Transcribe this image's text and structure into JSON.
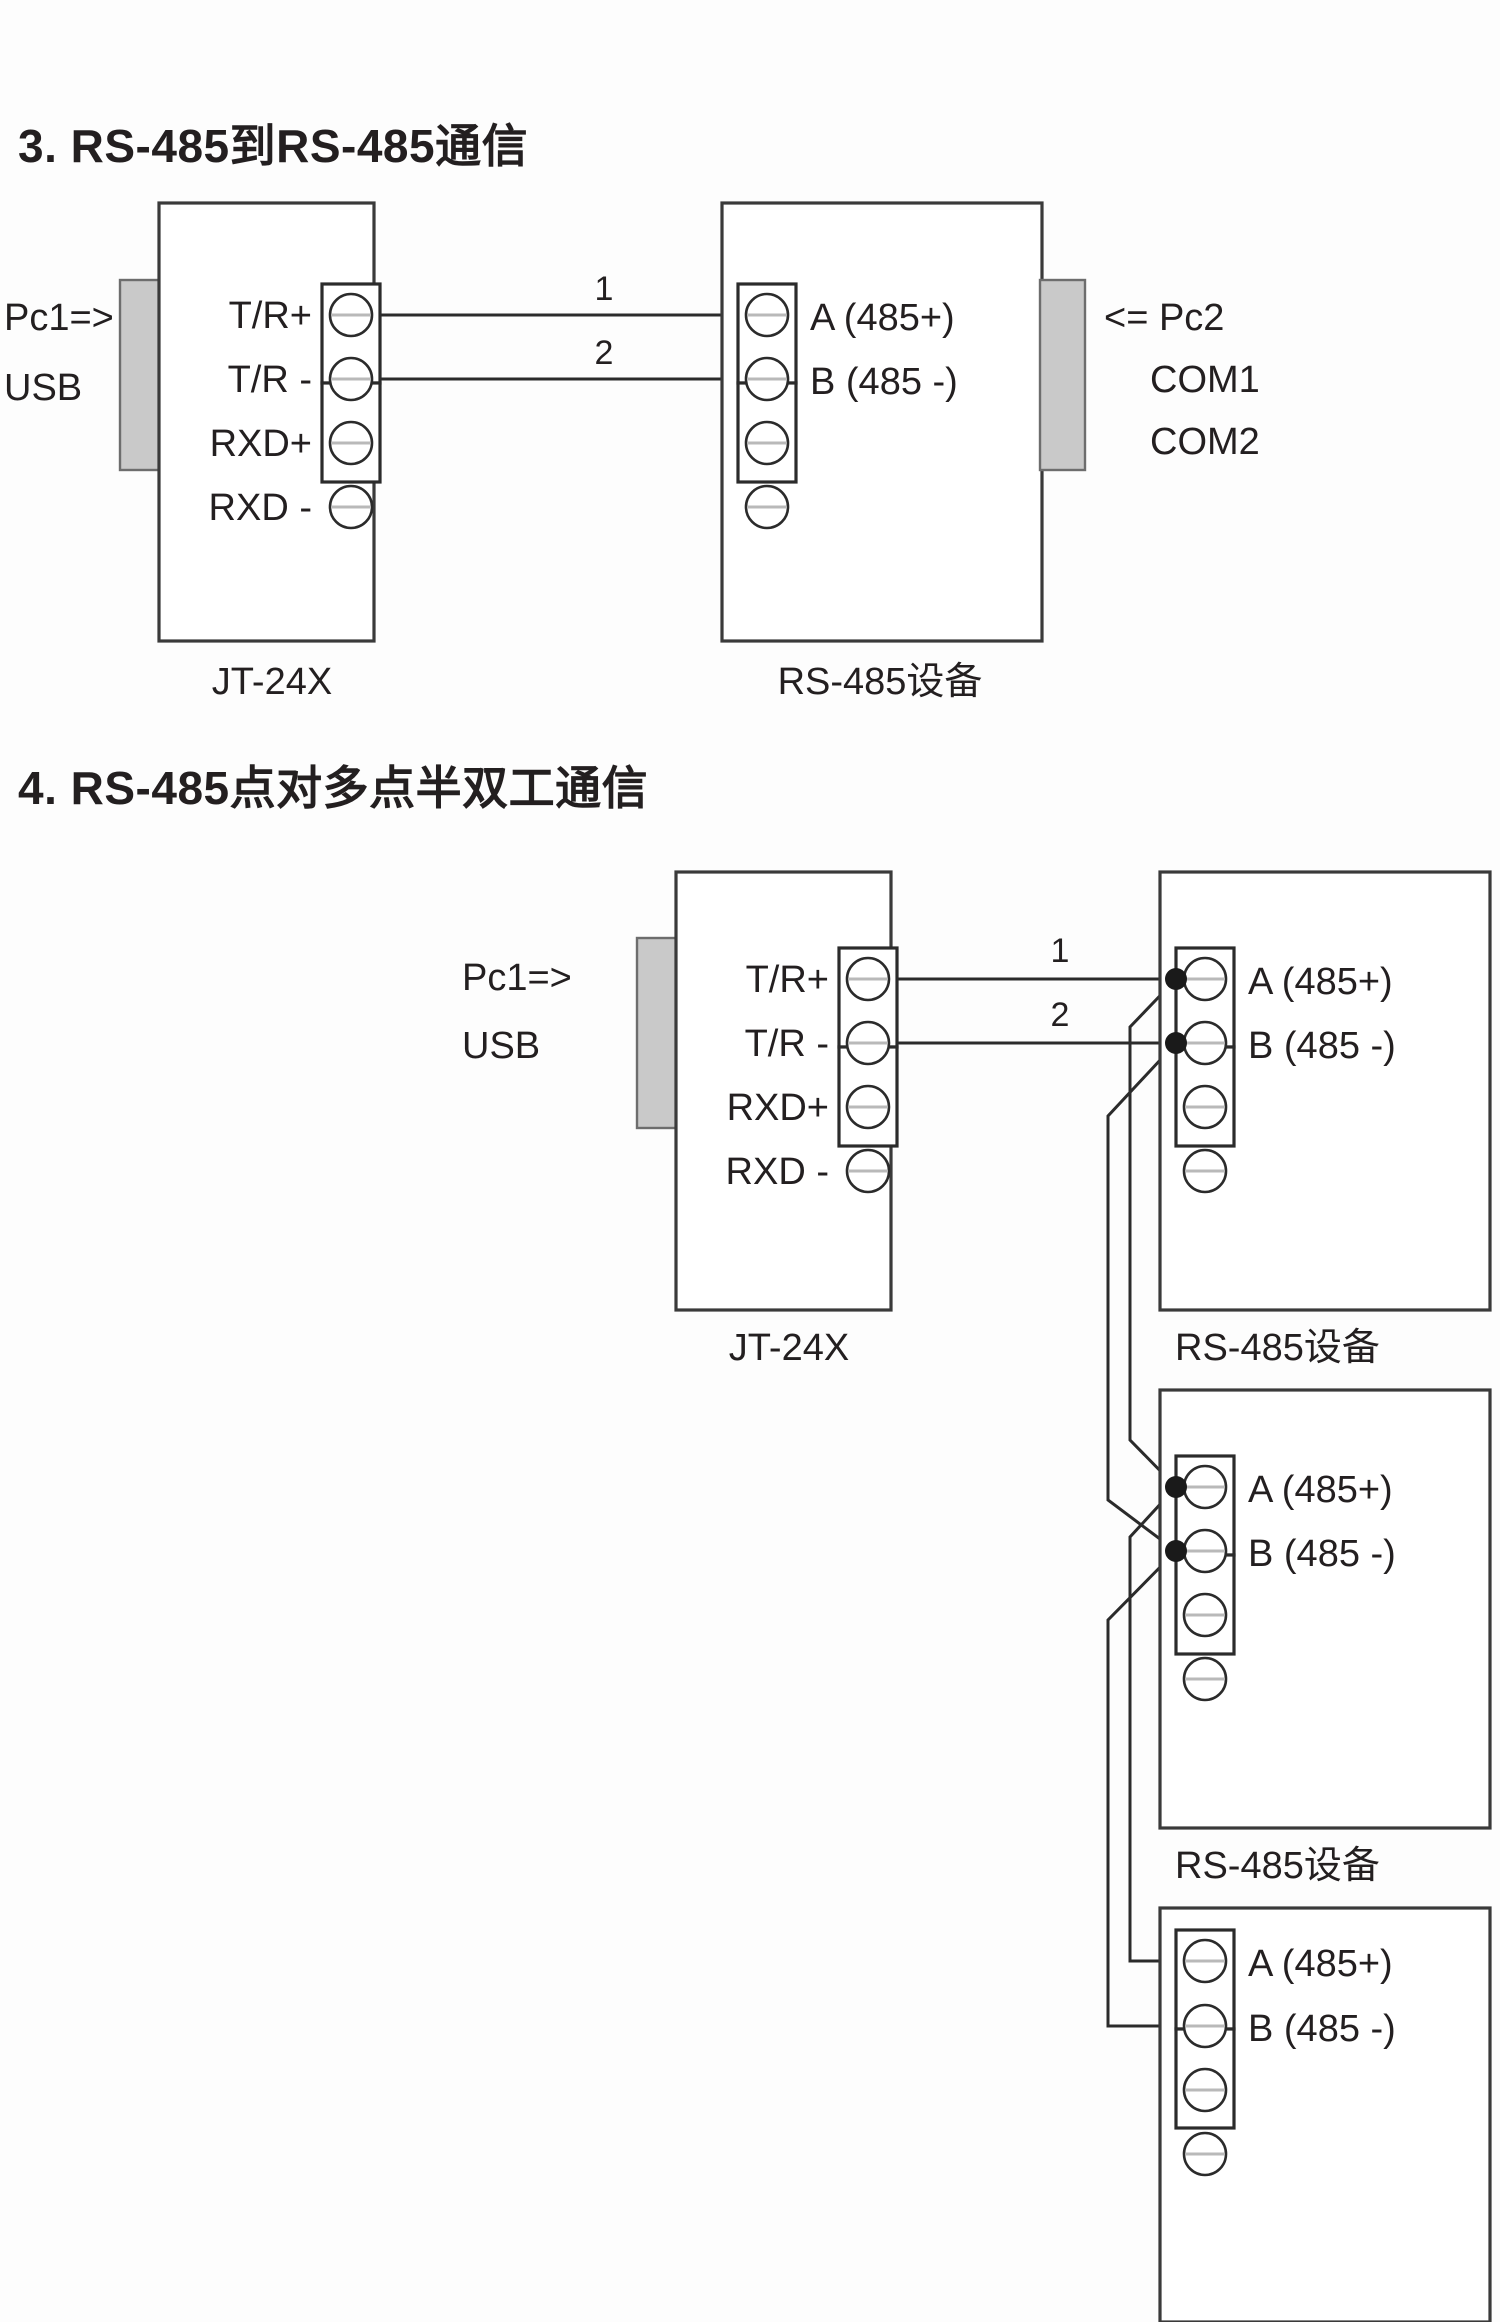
{
  "sections": [
    {
      "id": "section-3",
      "title": "3. RS-485到RS-485通信",
      "left_host": {
        "line1": "Pc1=>",
        "line2": "USB"
      },
      "right_host": {
        "line1": "<= Pc2",
        "line2": "COM1",
        "line3": "COM2"
      },
      "converter": {
        "caption": "JT-24X",
        "pins": [
          "T/R+",
          "T/R -",
          "RXD+",
          "RXD -"
        ]
      },
      "device": {
        "caption": "RS-485设备",
        "pins": [
          "A (485+)",
          "B (485 -)",
          "",
          ""
        ]
      },
      "wires": [
        {
          "number": "1",
          "from": "T/R+",
          "to": "A (485+)"
        },
        {
          "number": "2",
          "from": "T/R -",
          "to": "B (485 -)"
        }
      ]
    },
    {
      "id": "section-4",
      "title": "4. RS-485点对多点半双工通信",
      "left_host": {
        "line1": "Pc1=>",
        "line2": "USB"
      },
      "converter": {
        "caption": "JT-24X",
        "pins": [
          "T/R+",
          "T/R -",
          "RXD+",
          "RXD -"
        ]
      },
      "devices": [
        {
          "caption": "RS-485设备",
          "pins": [
            "A (485+)",
            "B (485 -)",
            "",
            ""
          ]
        },
        {
          "caption": "RS-485设备",
          "pins": [
            "A (485+)",
            "B (485 -)",
            "",
            ""
          ]
        },
        {
          "caption": "",
          "pins": [
            "A (485+)",
            "B (485 -)",
            "",
            ""
          ]
        }
      ],
      "wires": [
        {
          "number": "1",
          "from": "T/R+",
          "to": "A (485+)"
        },
        {
          "number": "2",
          "from": "T/R -",
          "to": "B (485 -)"
        }
      ]
    }
  ],
  "colors": {
    "ink": "#231f20",
    "line": "#2b2b2b",
    "connector_fill": "#c9c9c9",
    "screw_slot": "#b9b9b9",
    "background": "#fdfdfd"
  }
}
